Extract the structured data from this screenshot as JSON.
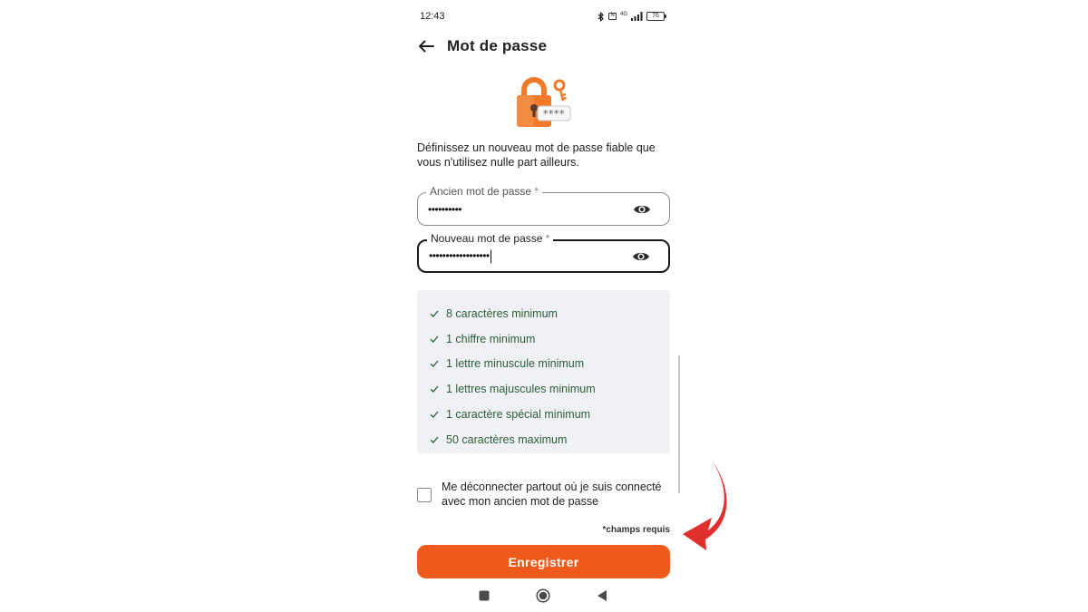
{
  "status": {
    "time": "12:43",
    "network": "4G",
    "battery": "76"
  },
  "header": {
    "title": "Mot de passe",
    "back_icon": "arrow-left-icon"
  },
  "hero": {
    "mask": "****",
    "colors": {
      "lock": "#f07a2a",
      "key": "#f07a2a"
    }
  },
  "intro": "Définissez un nouveau mot de passe fiable que vous n'utilisez nulle part ailleurs.",
  "fields": {
    "old": {
      "label": "Ancien mot de passe",
      "required_mark": "*",
      "value": "••••••••••"
    },
    "new": {
      "label": "Nouveau mot de passe",
      "required_mark": "*",
      "value": "••••••••••••••••••"
    }
  },
  "rules": [
    "8 caractères minimum",
    "1 chiffre minimum",
    "1 lettre minuscule minimum",
    "1 lettres majuscules minimum",
    "1 caractère spécial minimum",
    "50 caractères maximum"
  ],
  "logout": {
    "label": "Me déconnecter partout où je suis connecté avec mon ancien mot de passe",
    "checked": false
  },
  "required_note": "*champs requis",
  "save_label": "Enregistrer",
  "colors": {
    "accent": "#ee5a19",
    "rule_text": "#2e5d3a",
    "rules_bg": "#f0f1f4",
    "annotation_arrow": "#e0302e"
  },
  "nav": [
    "recents-square-icon",
    "home-circle-icon",
    "back-triangle-icon"
  ]
}
